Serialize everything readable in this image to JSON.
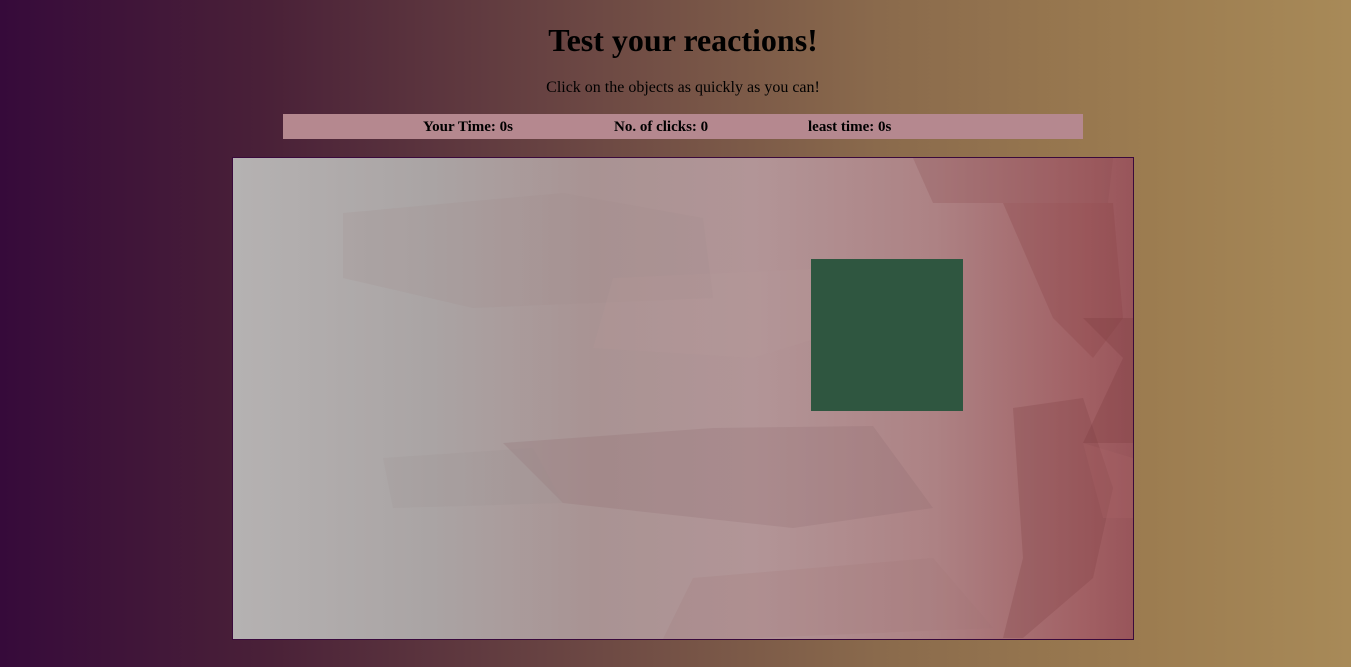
{
  "header": {
    "title": "Test your reactions!",
    "subtitle": "Click on the objects as quickly as you can!"
  },
  "stats": {
    "your_time": "Your Time: 0s",
    "clicks": "No. of clicks: 0",
    "least_time": "least time: 0s"
  },
  "game": {
    "target_color": "#2f5640",
    "target_shape": "square"
  }
}
